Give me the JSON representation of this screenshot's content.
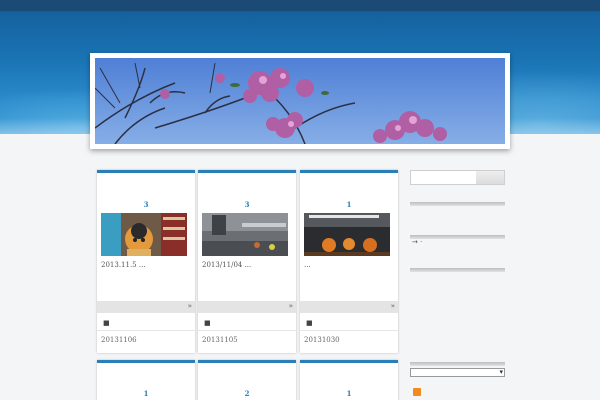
{
  "header": {
    "banner": "header-photo-flowers"
  },
  "posts": [
    {
      "count": "3",
      "excerpt": "2013.11.5 ...",
      "date": "20131106",
      "thumb": "doll-thumbnail"
    },
    {
      "count": "3",
      "excerpt": "2013/11/04 ...",
      "date": "20131105",
      "thumb": "station-thumbnail"
    },
    {
      "count": "1",
      "excerpt": "...",
      "date": "20131030",
      "thumb": "pumpkin-thumbnail"
    },
    {
      "count": "1"
    },
    {
      "count": "2"
    },
    {
      "count": "1"
    }
  ],
  "card_controls": {
    "expand": "»"
  },
  "sidebar": {
    "search_placeholder": "",
    "widget_text": "→  ·",
    "select_value": "",
    "select_arrow": "▾"
  },
  "colors": {
    "accent": "#2a7fb8",
    "sky": "#1a74b4",
    "rss": "#f28b1e"
  }
}
